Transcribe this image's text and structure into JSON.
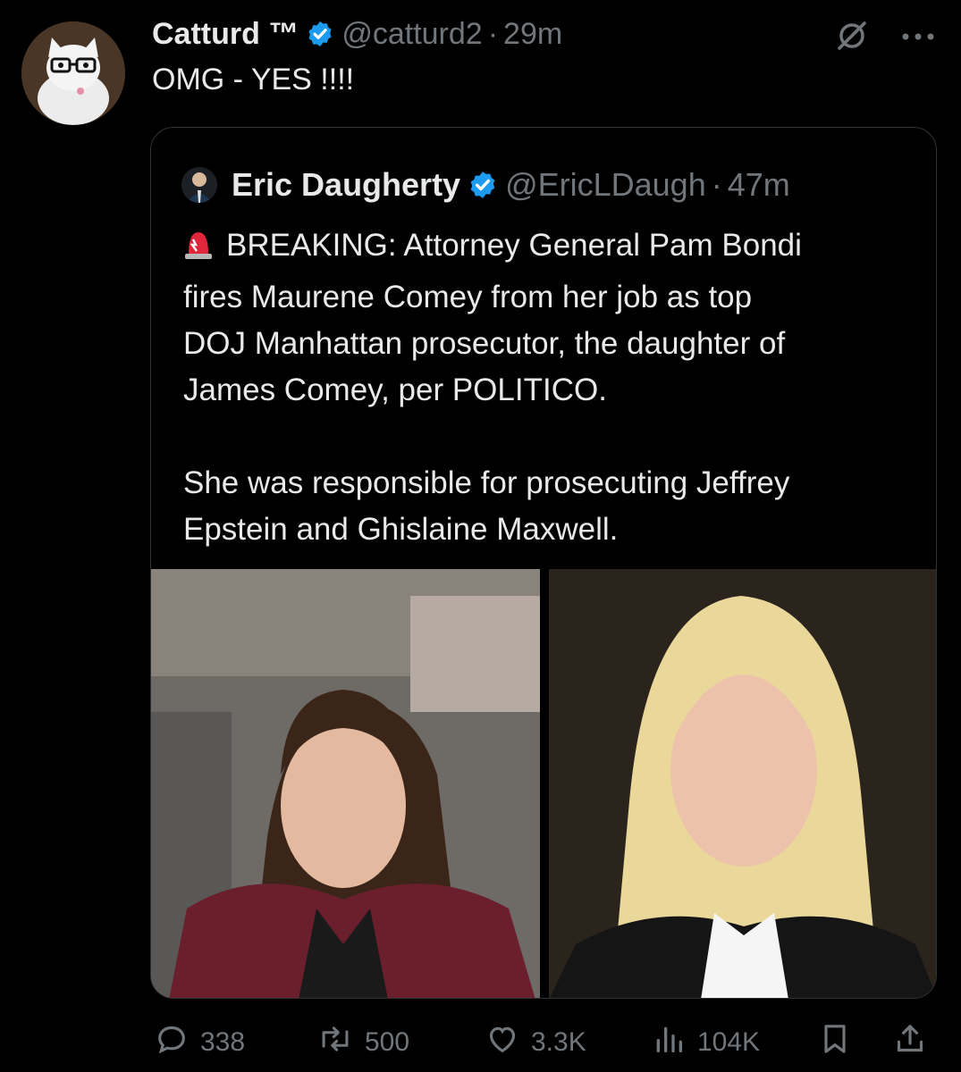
{
  "tweet": {
    "author_name": "Catturd ™",
    "handle": "@catturd2",
    "separator": "·",
    "time": "29m",
    "text": "OMG - YES !!!!"
  },
  "quote": {
    "author_name": "Eric Daugherty",
    "handle": "@EricLDaugh",
    "separator": "·",
    "time": "47m",
    "paragraph1_lines": [
      "BREAKING: Attorney General Pam Bondi",
      "fires Maurene Comey from her job as top",
      "DOJ Manhattan prosecutor, the daughter of",
      "James Comey, per POLITICO."
    ],
    "paragraph2_lines": [
      "She was responsible for prosecuting Jeffrey",
      "Epstein and Ghislaine Maxwell."
    ]
  },
  "actions": {
    "replies": "338",
    "reposts": "500",
    "likes": "3.3K",
    "views": "104K"
  },
  "icons": {
    "verified": "verified-badge-icon",
    "grok": "grok-icon",
    "more": "more-icon",
    "siren": "siren-emoji-icon",
    "reply": "reply-icon",
    "repost": "repost-icon",
    "like": "heart-icon",
    "views": "views-chart-icon",
    "bookmark": "bookmark-icon",
    "share": "share-icon"
  },
  "colors": {
    "background": "#000000",
    "text": "#e7e9ea",
    "muted": "#71767b",
    "verified": "#1d9bf0",
    "border": "#2f3336"
  }
}
